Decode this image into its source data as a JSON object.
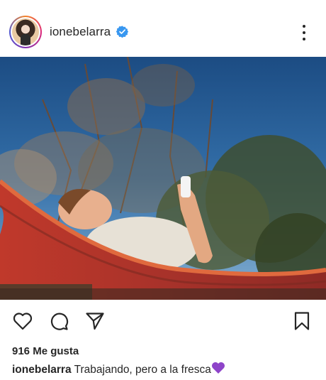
{
  "post": {
    "username": "ionebelarra",
    "verified": true,
    "likes_text": "916 Me gusta",
    "caption_user": "ionebelarra",
    "caption_text": "Trabajando, pero a la fresca",
    "caption_emoji": "purple-heart-icon"
  },
  "colors": {
    "verified_blue": "#3897f0",
    "text": "#262626",
    "emoji_purple": "#8e44c9"
  },
  "icons": {
    "like": "heart-icon",
    "comment": "comment-icon",
    "share": "send-icon",
    "save": "bookmark-icon",
    "menu": "more-options-icon"
  }
}
